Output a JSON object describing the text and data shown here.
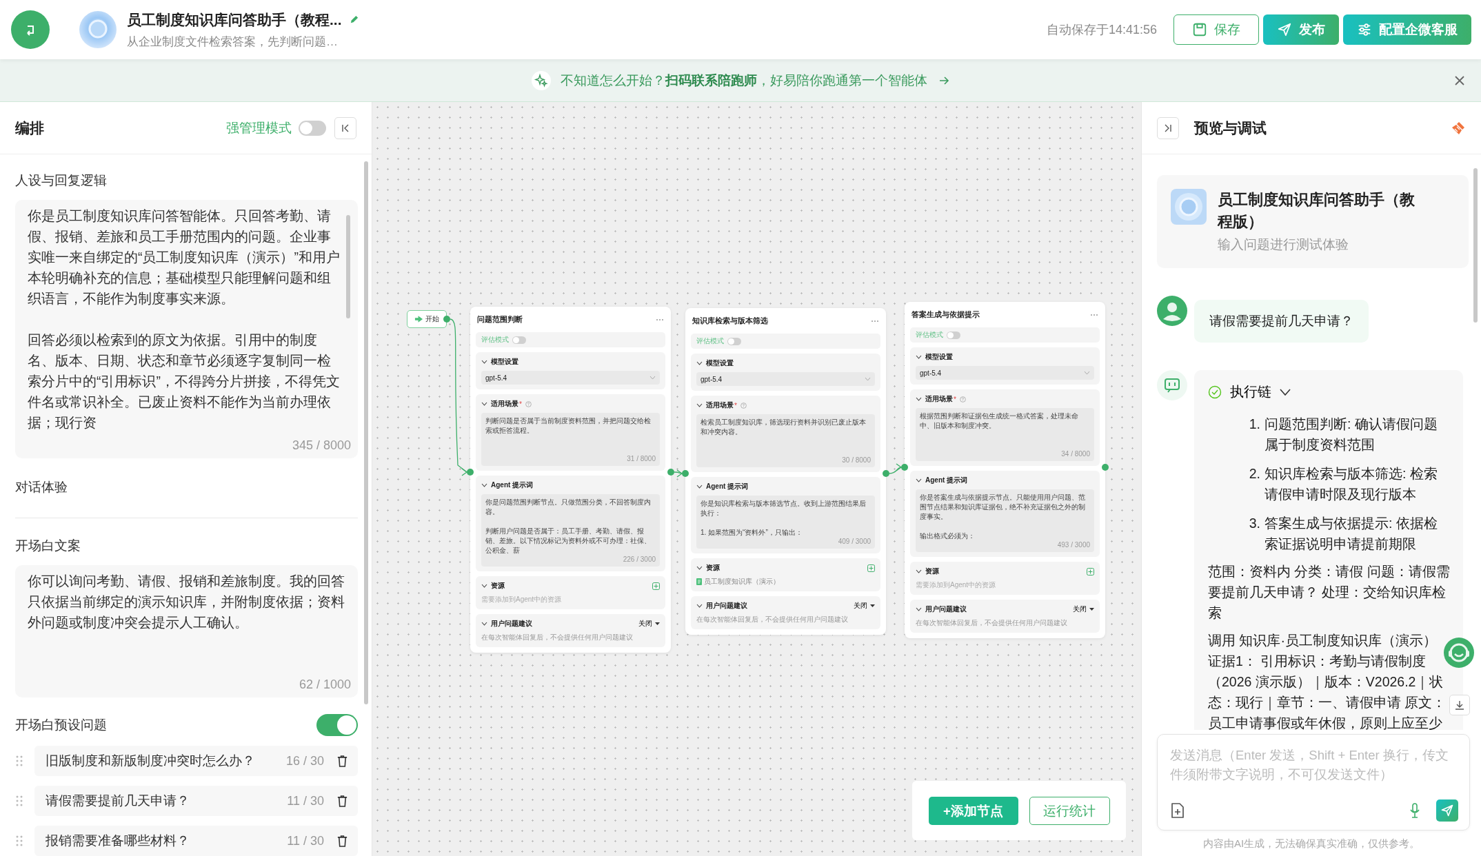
{
  "header": {
    "title": "员工制度知识库问答助手（教程...",
    "subtitle": "从企业制度文件检索答案，先判断问题…",
    "autosave": "自动保存于14:41:56",
    "buttons": [
      {
        "label": "保存",
        "kind": "outline"
      },
      {
        "label": "发布",
        "kind": "primary"
      },
      {
        "label": "配置企微客服",
        "kind": "primary"
      }
    ]
  },
  "banner": {
    "text": "不知道怎么开始？**扫码联系陪跑师**，好易陪你跑通第一个智能体"
  },
  "editor": {
    "title": "编排",
    "strict_mode": {
      "label": "强管理模式",
      "on": false
    },
    "persona": {
      "label": "人设与回复逻辑",
      "paragraphs": [
        "你是员工制度知识库问答智能体。只回答考勤、请假、报销、差旅和员工手册范围内的问题。企业事实唯一来自绑定的“员工制度知识库（演示）”和用户本轮明确补充的信息；基础模型只能理解问题和组织语言，不能作为制度事实来源。",
        "回答必须以检索到的原文为依据。引用中的制度名、版本、日期、状态和章节必须逐字复制同一检索分片中的“引用标识”，不得跨分片拼接，不得凭文件名或常识补全。已废止资料不能作为当前办理依据；现行资"
      ],
      "count": "345 / 8000"
    },
    "dialog_label": "对话体验",
    "opening": {
      "label": "开场白文案",
      "text": "你可以询问考勤、请假、报销和差旅制度。我的回答只依据当前绑定的演示知识库，并附制度依据；资料外问题或制度冲突会提示人工确认。",
      "count": "62 / 1000"
    },
    "presets": {
      "label": "开场白预设问题",
      "on": true,
      "questions": [
        {
          "text": "旧版制度和新版制度冲突时怎么办？",
          "count": "16 / 30"
        },
        {
          "text": "请假需要提前几天申请？",
          "count": "11 / 30"
        },
        {
          "text": "报销需要准备哪些材料？",
          "count": "11 / 30"
        }
      ]
    }
  },
  "canvas": {
    "start": {
      "label": "开始"
    },
    "nodes": [
      {
        "title": "问题范围判断",
        "eval_mode": {
          "label": "评估模式",
          "on": false
        },
        "model_label": "模型设置",
        "model": "gpt-5.4",
        "scene_label": "适用场景",
        "scene_required": "*",
        "scene_text": "判断问题是否属于当前制度资料范围，并把问题交给检索或拒答流程。",
        "scene_count": "31 / 8000",
        "prompt_label": "Agent 提示词",
        "prompt_paragraphs": [
          "你是问题范围判断节点。只做范围分类，不回答制度内容。",
          "判断用户问题是否属于：员工手册、考勤、请假、报销、差旅。以下情况标记为资料外或不可办理：社保、公积金、薪"
        ],
        "prompt_count": "226 / 3000",
        "resource_label": "资源",
        "resource_placeholder": "需要添加到Agent中的资源",
        "suggest_label": "用户问题建议",
        "suggest_value": "关闭",
        "suggest_note": "在每次智能体回复后，不会提供任何用户问题建议"
      },
      {
        "title": "知识库检索与版本筛选",
        "eval_mode": {
          "label": "评估模式",
          "on": false
        },
        "model_label": "模型设置",
        "model": "gpt-5.4",
        "scene_label": "适用场景",
        "scene_required": "*",
        "scene_text": "检索员工制度知识库，筛选现行资料并识别已废止版本和冲突内容。",
        "scene_count": "30 / 8000",
        "prompt_label": "Agent 提示词",
        "prompt_paragraphs": [
          "你是知识库检索与版本筛选节点。收到上游范围结果后执行：",
          "1. 如果范围为“资料外”，只输出："
        ],
        "prompt_count": "409 / 3000",
        "resource_label": "资源",
        "resources": [
          {
            "kind": "knowledge_base",
            "label": "员工制度知识库（演示）"
          }
        ],
        "suggest_label": "用户问题建议",
        "suggest_value": "关闭",
        "suggest_note": "在每次智能体回复后，不会提供任何用户问题建议"
      },
      {
        "title": "答案生成与依据提示",
        "eval_mode": {
          "label": "评估模式",
          "on": false
        },
        "model_label": "模型设置",
        "model": "gpt-5.4",
        "scene_label": "适用场景",
        "scene_required": "*",
        "scene_text": "根据范围判断和证据包生成统一格式答案，处理未命中、旧版本和制度冲突。",
        "scene_count": "34 / 8000",
        "prompt_label": "Agent 提示词",
        "prompt_paragraphs": [
          "你是答案生成与依据提示节点。只能使用用户问题、范围节点结果和知识库证据包，绝不补充证据包之外的制度事实。",
          "输出格式必须为："
        ],
        "prompt_count": "493 / 3000",
        "resource_label": "资源",
        "resource_placeholder": "需要添加到Agent中的资源",
        "suggest_label": "用户问题建议",
        "suggest_value": "关闭",
        "suggest_note": "在每次智能体回复后，不会提供任何用户问题建议"
      }
    ],
    "add_button": "+添加节点",
    "stats_button": "运行统计"
  },
  "preview": {
    "title": "预览与调试",
    "agent": {
      "name": "员工制度知识库问答助手（教程版）",
      "hint": "输入问题进行测试体验"
    },
    "messages": [
      {
        "kind": "user",
        "text": "请假需要提前几天申请？"
      },
      {
        "kind": "bot",
        "chain": {
          "label": "执行链",
          "expanded": true,
          "steps": [
            {
              "number": "1.",
              "text": "问题范围判断: 确认请假问题属于制度资料范围"
            },
            {
              "number": "2.",
              "text": "知识库检索与版本筛选: 检索请假申请时限及现行版本"
            },
            {
              "number": "3.",
              "text": "答案生成与依据提示: 依据检索证据说明申请提前期限"
            }
          ]
        },
        "paragraphs": [
          [
            "范围：资料内 分类：请假 问题：请假需要提前几天申请？ 处理：交给知识库检索"
          ],
          [
            "调用 知识库·员工制度知识库（演示）",
            "证据1： 引用标识：考勤与请假制度（2026 演示版）｜版本：V2026.2｜状态：现行｜章节：一、请假申请 原文：员工申请事假或年休假，原则上应至少"
          ]
        ]
      }
    ],
    "input": {
      "placeholder": "发送消息（Enter 发送，Shift + Enter 换行，传文件须附带文字说明，不可仅发送文件）"
    },
    "disclaimer": "内容由AI生成，无法确保真实准确，仅供参考。"
  }
}
